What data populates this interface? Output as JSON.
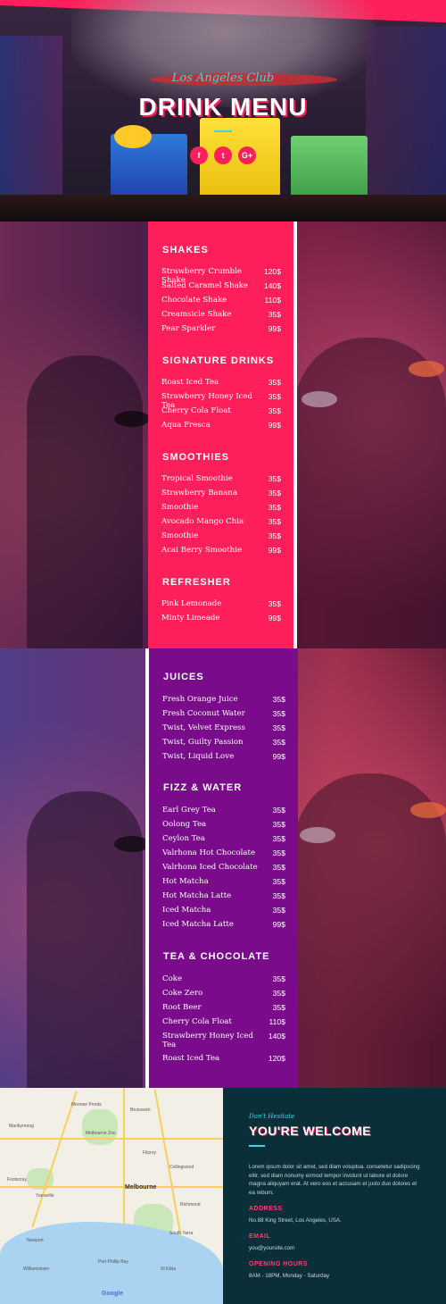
{
  "hero": {
    "subtitle": "Los Angeles Club",
    "title": "DRINK MENU",
    "social": [
      {
        "icon": "facebook-icon",
        "glyph": "f"
      },
      {
        "icon": "twitter-icon",
        "glyph": "t"
      },
      {
        "icon": "google-plus-icon",
        "glyph": "G+"
      }
    ]
  },
  "menu_pink": [
    {
      "category": "SHAKES",
      "items": [
        {
          "name": "Strawberry Crumble Shake",
          "price": "120$"
        },
        {
          "name": "Salted Caramel Shake",
          "price": "140$"
        },
        {
          "name": "Chocolate Shake",
          "price": "110$"
        },
        {
          "name": "Creamsicle Shake",
          "price": "35$"
        },
        {
          "name": "Pear Sparkler",
          "price": "99$"
        }
      ]
    },
    {
      "category": "SIGNATURE DRINKS",
      "items": [
        {
          "name": "Roast Iced Tea",
          "price": "35$"
        },
        {
          "name": "Strawberry Honey Iced Tea",
          "price": "35$"
        },
        {
          "name": "Cherry Cola Float",
          "price": "35$"
        },
        {
          "name": "Aqua Fresca",
          "price": "99$"
        }
      ]
    },
    {
      "category": "SMOOTHIES",
      "items": [
        {
          "name": "Tropical Smoothie",
          "price": "35$"
        },
        {
          "name": "Strawberry Banana",
          "price": "35$"
        },
        {
          "name": "Smoothie",
          "price": "35$"
        },
        {
          "name": "Avocado Mango Chia",
          "price": "35$"
        },
        {
          "name": "Smoothie",
          "price": "35$"
        },
        {
          "name": "Acai Berry Smoothie",
          "price": "99$"
        }
      ]
    },
    {
      "category": "REFRESHER",
      "items": [
        {
          "name": "Pink Lemonade",
          "price": "35$"
        },
        {
          "name": "Minty Limeade",
          "price": "99$"
        }
      ]
    }
  ],
  "menu_purple": [
    {
      "category": "JUICES",
      "items": [
        {
          "name": "Fresh Orange Juice",
          "price": "35$"
        },
        {
          "name": "Fresh Coconut Water",
          "price": "35$"
        },
        {
          "name": "Twist, Velvet Express",
          "price": "35$"
        },
        {
          "name": "Twist, Guilty Passion",
          "price": "35$"
        },
        {
          "name": "Twist, Liquid Love",
          "price": "99$"
        }
      ]
    },
    {
      "category": "FIZZ & WATER",
      "items": [
        {
          "name": "Earl Grey Tea",
          "price": "35$"
        },
        {
          "name": "Oolong Tea",
          "price": "35$"
        },
        {
          "name": "Ceylon Tea",
          "price": "35$"
        },
        {
          "name": "Valrhona Hot Chocolate",
          "price": "35$"
        },
        {
          "name": "Valrhona Iced Chocolate",
          "price": "35$"
        },
        {
          "name": "Hot Matcha",
          "price": "35$"
        },
        {
          "name": "Hot Matcha Latte",
          "price": "35$"
        },
        {
          "name": "Iced Matcha",
          "price": "35$"
        },
        {
          "name": "Iced Matcha Latte",
          "price": "99$"
        }
      ]
    },
    {
      "category": "TEA & CHOCOLATE",
      "items": [
        {
          "name": "Coke",
          "price": "35$"
        },
        {
          "name": "Coke Zero",
          "price": "35$"
        },
        {
          "name": "Root Beer",
          "price": "35$"
        },
        {
          "name": "Cherry Cola Float",
          "price": "110$"
        },
        {
          "name": "Strawberry Honey Iced Tea",
          "price": "140$"
        },
        {
          "name": "Roast Iced Tea",
          "price": "120$"
        }
      ]
    }
  ],
  "map": {
    "labels": [
      "Moonee Ponds",
      "Brunswick",
      "Maribyrnong",
      "Melbourne Zoo",
      "Melbourne",
      "Richmond",
      "Williamstown",
      "St Kilda",
      "South Yarra",
      "Port Phillip Bay",
      "Footscray",
      "Yarraville",
      "Newport",
      "Fitzroy",
      "Collingwood"
    ],
    "attribution": "Google"
  },
  "contact": {
    "kicker": "Don't Hesitate",
    "heading": "YOU'RE WELCOME",
    "body": "Lorem ipsum dolor sit amet, sed diam voluptua. consetetur sadipscing elitr, sed diam nonumy eirmod tempor invidunt ut labore et dolore magna aliquyam erat. At vero eos et accusam et justo duo dolores et ea rebum.",
    "address_label": "ADDRESS",
    "address": "No.88 King Street, Los Angeles, USA.",
    "email_label": "EMAIL",
    "email": "you@yoursite.com",
    "hours_label": "OPENING HOURS",
    "hours": "8AM - 18PM, Monday - Saturday"
  },
  "colors": {
    "pink": "#ff1f5a",
    "purple": "#7a0c8c",
    "cyan": "#39d7e6",
    "dark_teal": "#0b2f38"
  }
}
